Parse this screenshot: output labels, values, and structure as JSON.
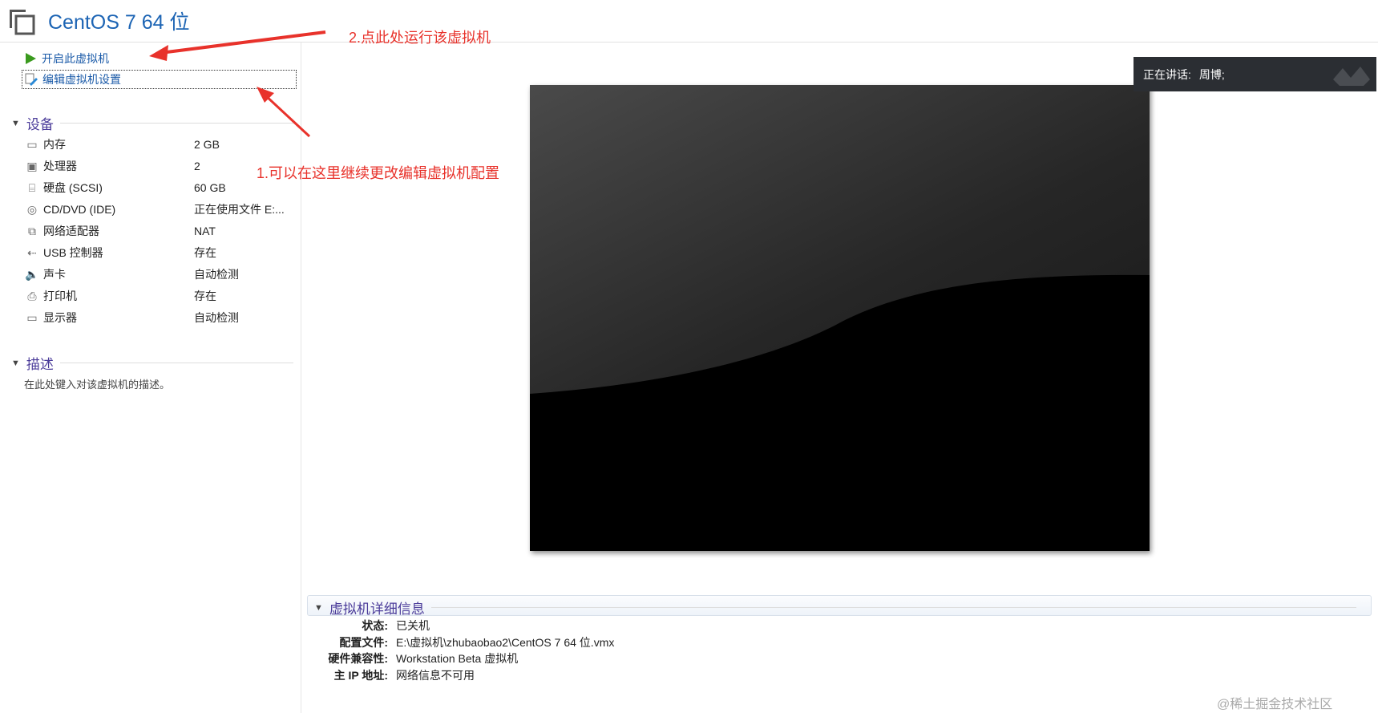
{
  "title": "CentOS 7 64 位",
  "actions": {
    "power_on": "开启此虚拟机",
    "edit_settings": "编辑虚拟机设置"
  },
  "devices": {
    "header": "设备",
    "items": [
      {
        "icon": "memory-icon",
        "name": "内存",
        "value": "2 GB"
      },
      {
        "icon": "cpu-icon",
        "name": "处理器",
        "value": "2"
      },
      {
        "icon": "harddisk-icon",
        "name": "硬盘 (SCSI)",
        "value": "60 GB"
      },
      {
        "icon": "cd-icon",
        "name": "CD/DVD (IDE)",
        "value": "正在使用文件 E:..."
      },
      {
        "icon": "network-icon",
        "name": "网络适配器",
        "value": "NAT"
      },
      {
        "icon": "usb-icon",
        "name": "USB 控制器",
        "value": "存在"
      },
      {
        "icon": "speaker-icon",
        "name": "声卡",
        "value": "自动检测"
      },
      {
        "icon": "printer-icon",
        "name": "打印机",
        "value": "存在"
      },
      {
        "icon": "monitor-icon",
        "name": "显示器",
        "value": "自动检测"
      }
    ]
  },
  "description": {
    "header": "描述",
    "placeholder": "在此处键入对该虚拟机的描述。"
  },
  "details": {
    "header": "虚拟机详细信息",
    "rows": [
      {
        "label": "状态:",
        "value": "已关机"
      },
      {
        "label": "配置文件:",
        "value": "E:\\虚拟机\\zhubaobao2\\CentOS 7 64 位.vmx"
      },
      {
        "label": "硬件兼容性:",
        "value": "Workstation Beta 虚拟机"
      },
      {
        "label": "主 IP 地址:",
        "value": "网络信息不可用"
      }
    ]
  },
  "speaking": {
    "label": "正在讲话:",
    "name": "周博;"
  },
  "annotations": {
    "a1": "1.可以在这里继续更改编辑虚拟机配置",
    "a2": "2.点此处运行该虚拟机"
  },
  "watermark": "@稀土掘金技术社区",
  "colors": {
    "accent": "#1c64b4",
    "annotation": "#e8322b",
    "section": "#4b3c9a"
  }
}
